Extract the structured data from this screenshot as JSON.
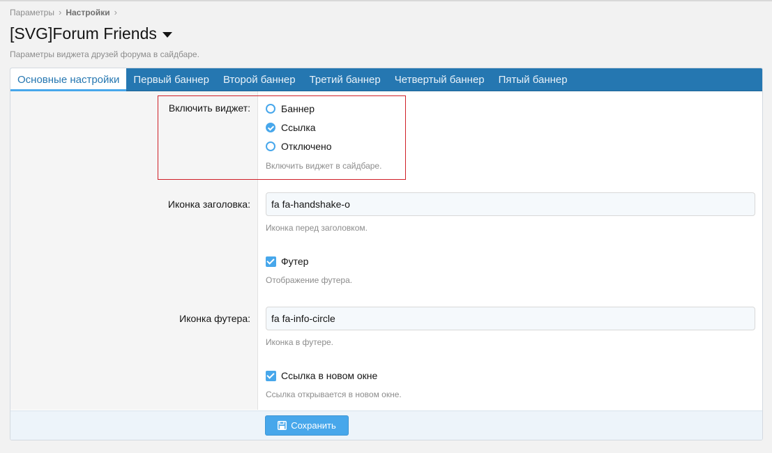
{
  "breadcrumb": {
    "items": [
      "Параметры",
      "Настройки"
    ],
    "separator": "›"
  },
  "page": {
    "title": "[SVG]Forum Friends",
    "description": "Параметры виджета друзей форума в сайдбаре."
  },
  "tabs": [
    {
      "label": "Основные настройки",
      "active": true
    },
    {
      "label": "Первый баннер",
      "active": false
    },
    {
      "label": "Второй баннер",
      "active": false
    },
    {
      "label": "Третий баннер",
      "active": false
    },
    {
      "label": "Четвертый баннер",
      "active": false
    },
    {
      "label": "Пятый баннер",
      "active": false
    }
  ],
  "form": {
    "enable_widget": {
      "label": "Включить виджет:",
      "options": [
        {
          "label": "Баннер",
          "checked": false
        },
        {
          "label": "Ссылка",
          "checked": true
        },
        {
          "label": "Отключено",
          "checked": false
        }
      ],
      "hint": "Включить виджет в сайдбаре."
    },
    "header_icon": {
      "label": "Иконка заголовка:",
      "value": "fa fa-handshake-o",
      "hint": "Иконка перед заголовком."
    },
    "footer": {
      "label": "Футер",
      "checked": true,
      "hint": "Отображение футера."
    },
    "footer_icon": {
      "label": "Иконка футера:",
      "value": "fa fa-info-circle",
      "hint": "Иконка в футере."
    },
    "new_window": {
      "label": "Ссылка в новом окне",
      "checked": true,
      "hint": "Ссылка открывается в новом окне."
    }
  },
  "actions": {
    "save_label": "Сохранить",
    "save_icon": "floppy-disk-icon"
  },
  "colors": {
    "tab_bar": "#2577b1",
    "accent": "#47a7eb",
    "highlight_border": "#cf1f27"
  }
}
